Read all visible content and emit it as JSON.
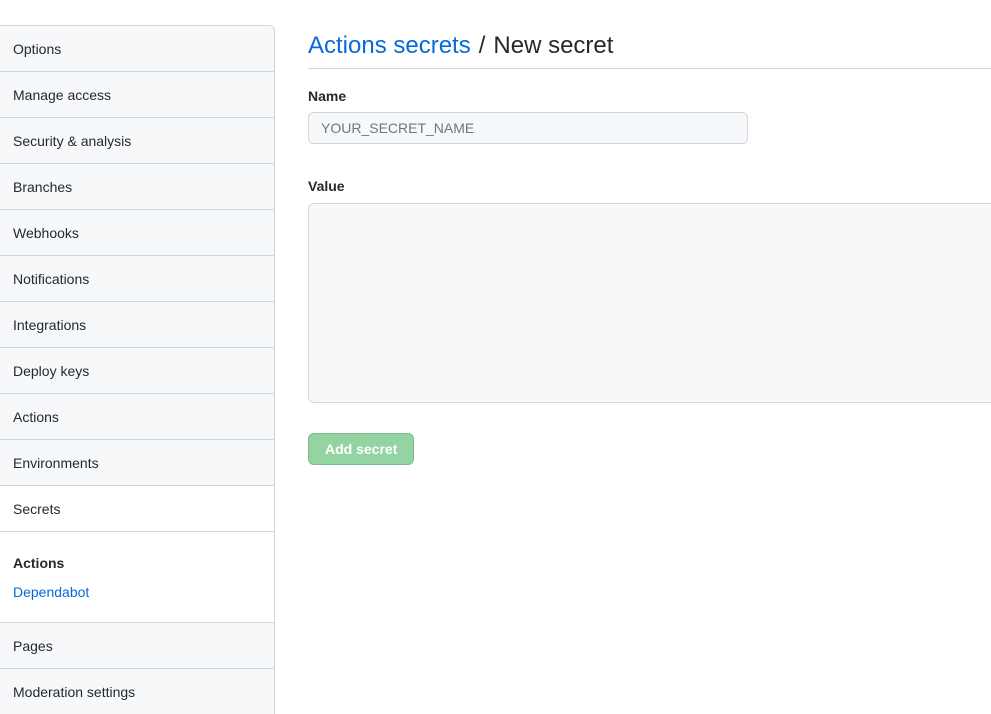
{
  "sidebar": {
    "items_top": [
      {
        "label": "Options"
      },
      {
        "label": "Manage access"
      },
      {
        "label": "Security & analysis"
      },
      {
        "label": "Branches"
      },
      {
        "label": "Webhooks"
      },
      {
        "label": "Notifications"
      },
      {
        "label": "Integrations"
      },
      {
        "label": "Deploy keys"
      },
      {
        "label": "Actions"
      },
      {
        "label": "Environments"
      },
      {
        "label": "Secrets",
        "selected": true
      }
    ],
    "subnav": {
      "heading": "Actions",
      "link": "Dependabot"
    },
    "items_bottom": [
      {
        "label": "Pages"
      },
      {
        "label": "Moderation settings"
      }
    ]
  },
  "header": {
    "breadcrumb_link": "Actions secrets",
    "separator": "/",
    "current": "New secret"
  },
  "form": {
    "name_label": "Name",
    "name_placeholder": "YOUR_SECRET_NAME",
    "name_value": "",
    "value_label": "Value",
    "value_text": "",
    "submit_label": "Add secret"
  },
  "colors": {
    "link": "#0969da",
    "button_disabled": "#94d3a2",
    "border": "#d0d7de",
    "field_bg": "#f6f8fa"
  }
}
